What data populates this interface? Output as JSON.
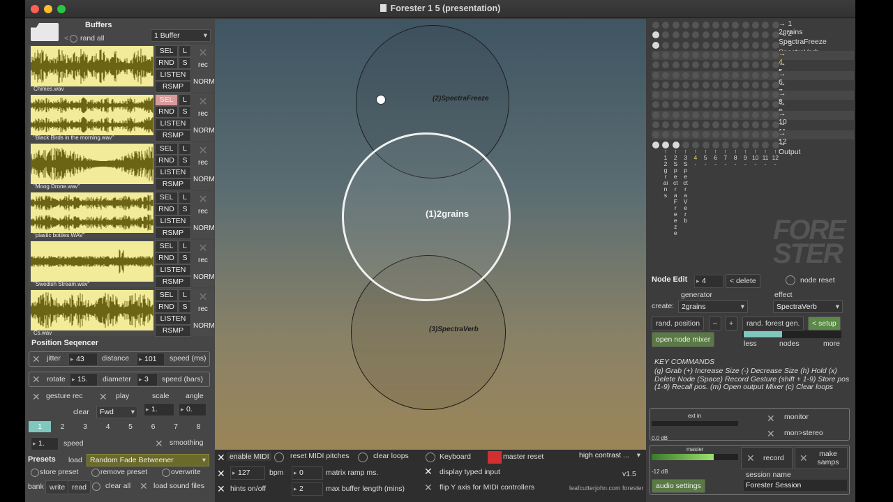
{
  "window": {
    "title": "Forester 1 5 (presentation)"
  },
  "buffers": {
    "title": "Buffers",
    "rand_all": "rand all",
    "count_select": "1 Buffer",
    "items": [
      {
        "name": "Chimes.wav",
        "sel": "SEL",
        "l": "L",
        "rnd": "RND",
        "s": "S",
        "listen": "LISTEN",
        "rsmp": "RSMP",
        "rec": "rec",
        "norm": "NORM"
      },
      {
        "name": "\"Black Birds in the morning.wav\"",
        "sel": "SEL",
        "l": "L",
        "rnd": "RND",
        "s": "S",
        "listen": "LISTEN",
        "rsmp": "RSMP",
        "rec": "rec",
        "norm": "NORM"
      },
      {
        "name": "\"Moog Drone.wav\"",
        "sel": "SEL",
        "l": "L",
        "rnd": "RND",
        "s": "S",
        "listen": "LISTEN",
        "rsmp": "RSMP",
        "rec": "rec",
        "norm": "NORM"
      },
      {
        "name": "\"plastic bottles.WAV\"",
        "sel": "SEL",
        "l": "L",
        "rnd": "RND",
        "s": "S",
        "listen": "LISTEN",
        "rsmp": "RSMP",
        "rec": "rec",
        "norm": "NORM"
      },
      {
        "name": "\"Swedish Stream.wav\"",
        "sel": "SEL",
        "l": "L",
        "rnd": "RND",
        "s": "S",
        "listen": "LISTEN",
        "rsmp": "RSMP",
        "rec": "rec",
        "norm": "NORM"
      },
      {
        "name": "Cs.wav",
        "sel": "SEL",
        "l": "L",
        "rnd": "RND",
        "s": "S",
        "listen": "LISTEN",
        "rsmp": "RSMP",
        "rec": "rec",
        "norm": "NORM"
      }
    ],
    "selected_index": 1
  },
  "sequencer": {
    "title": "Position Seqencer",
    "jitter_label": "jitter",
    "jitter": "43",
    "distance_label": "distance",
    "distance": "101",
    "speed_ms_label": "speed (ms)",
    "rotate_label": "rotate",
    "rotate": "15.",
    "diameter_label": "diameter",
    "diameter": "3",
    "speed_bars_label": "speed (bars)",
    "gesture_rec": "gesture rec",
    "play": "play",
    "scale": "scale",
    "angle": "angle",
    "clear": "clear",
    "direction": "Fwd",
    "scale_val": "1.",
    "angle_val": "0.",
    "steps": [
      "1",
      "2",
      "3",
      "4",
      "5",
      "6",
      "7",
      "8"
    ],
    "speed_val": "1.",
    "speed_label": "speed",
    "smoothing": "smoothing"
  },
  "presets": {
    "title": "Presets",
    "load": "load",
    "preset_value": "Random Fade Betweener",
    "store": "store preset",
    "remove": "remove preset",
    "overwrite": "overwrite",
    "bank": "bank",
    "write": "write",
    "read": "read",
    "clear_all": "clear all",
    "load_sound_files": "load sound files"
  },
  "nodes": [
    {
      "label": "(2)SpectraFreeze"
    },
    {
      "label": "(1)2grains"
    },
    {
      "label": "(3)SpectraVerb"
    }
  ],
  "bottom": {
    "enable_midi": "enable MIDI",
    "reset_midi": "reset MIDI pitches",
    "clear_loops": "clear loops",
    "keyboard": "Keyboard",
    "master_reset": "master reset",
    "contrast": "high contrast ...",
    "bpm_val": "127",
    "bpm": "bpm",
    "ramp_val": "0",
    "ramp": "matrix ramp ms.",
    "display_typed": "display typed input",
    "version": "v1.5",
    "hints": "hints on/off",
    "maxbuf_val": "2",
    "maxbuf": "max buffer length (mins)",
    "flip_y": "flip Y axis for MIDI controllers",
    "credit": "leafcutterjohn.com forester"
  },
  "matrix": {
    "rows": [
      "1 2grains",
      "2 SpectraFreeze",
      "3 SpectraVerb",
      "4 -",
      "5 -",
      "6 -",
      "7 -",
      "8 -",
      "9 -",
      "10 -",
      "11 -",
      "12 -",
      "Output"
    ],
    "cols": [
      "1",
      "2",
      "3",
      "4",
      "5",
      "6",
      "7",
      "8",
      "9",
      "10",
      "11",
      "12"
    ],
    "col_names": [
      "2grains",
      "SpectraFreeze",
      "SpectraVerb",
      "-",
      "-",
      "-",
      "-",
      "-",
      "-",
      "-",
      "-",
      "-"
    ]
  },
  "logo": {
    "text1": "FORE",
    "text2": "STER"
  },
  "node_edit": {
    "title": "Node Edit",
    "node_val": "4",
    "delete": "< delete",
    "node_reset": "node reset",
    "generator": "generator",
    "effect": "effect",
    "create": "create:",
    "gen_val": "2grains",
    "effect_val": "SpectraVerb",
    "rand_position": "rand. position",
    "minus": "–",
    "plus": "+",
    "rand_forest": "rand. forest gen.",
    "setup": "< setup",
    "open_mixer": "open node mixer",
    "less": "less",
    "nodes": "nodes",
    "more": "more",
    "nodes_level": 0.4
  },
  "key_commands": {
    "title": "KEY COMMANDS",
    "text": "(g) Grab    (+) Increase Size   (-) Decrease Size   (h) Hold (x) Delete Node  (Space) Record Gesture   (shift + 1-9) Store pos   (1-9) Recall pos. (m) Open output Mixer  (c) Clear loops"
  },
  "io": {
    "ext_in": "ext in",
    "ext_db": "0.0 dB",
    "monitor": "monitor",
    "mon_stereo": "mon>stereo",
    "master": "master",
    "master_db": "-12 dB",
    "record": "record",
    "make_samps": "make samps",
    "audio_settings": "audio settings",
    "session_name_label": "session name",
    "session_name": "Forester Session",
    "master_level": 0.72
  },
  "colors": {
    "accent_teal": "#7ec8c0",
    "active_green": "#8dbb6a",
    "sel_pink": "#d99a9a",
    "reset_red": "#d03030",
    "wave_bg": "#f2ec9a",
    "wave": "#6b6414"
  }
}
